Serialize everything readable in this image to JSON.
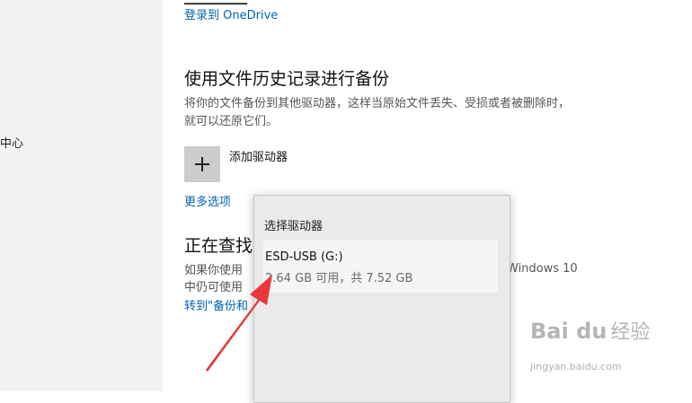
{
  "sidebar": {
    "partial_item": "中心"
  },
  "main": {
    "onedrive_link": "登录到 OneDrive",
    "file_history": {
      "title": "使用文件历史记录进行备份",
      "description": "将你的文件备份到其他驱动器，这样当原始文件丢失、受损或者被删除时，就可以还原它们。",
      "add_drive_label": "添加驱动器",
      "more_options": "更多选项"
    },
    "older_backup": {
      "title_partial": "正在查找",
      "desc_line1": "如果你使用",
      "desc_line2": "中仍可使用",
      "desc_right": "Windows 10",
      "link_partial": "转到\"备份和"
    }
  },
  "flyout": {
    "title": "选择驱动器",
    "drives": [
      {
        "name": "ESD-USB (G:)",
        "space": "2.64 GB 可用，共 7.52 GB"
      }
    ]
  },
  "annotation": {
    "arrow_color": "#e8383a"
  },
  "watermark": {
    "logo": "Bai du",
    "text": "经验",
    "url": "jingyan.baidu.com"
  }
}
